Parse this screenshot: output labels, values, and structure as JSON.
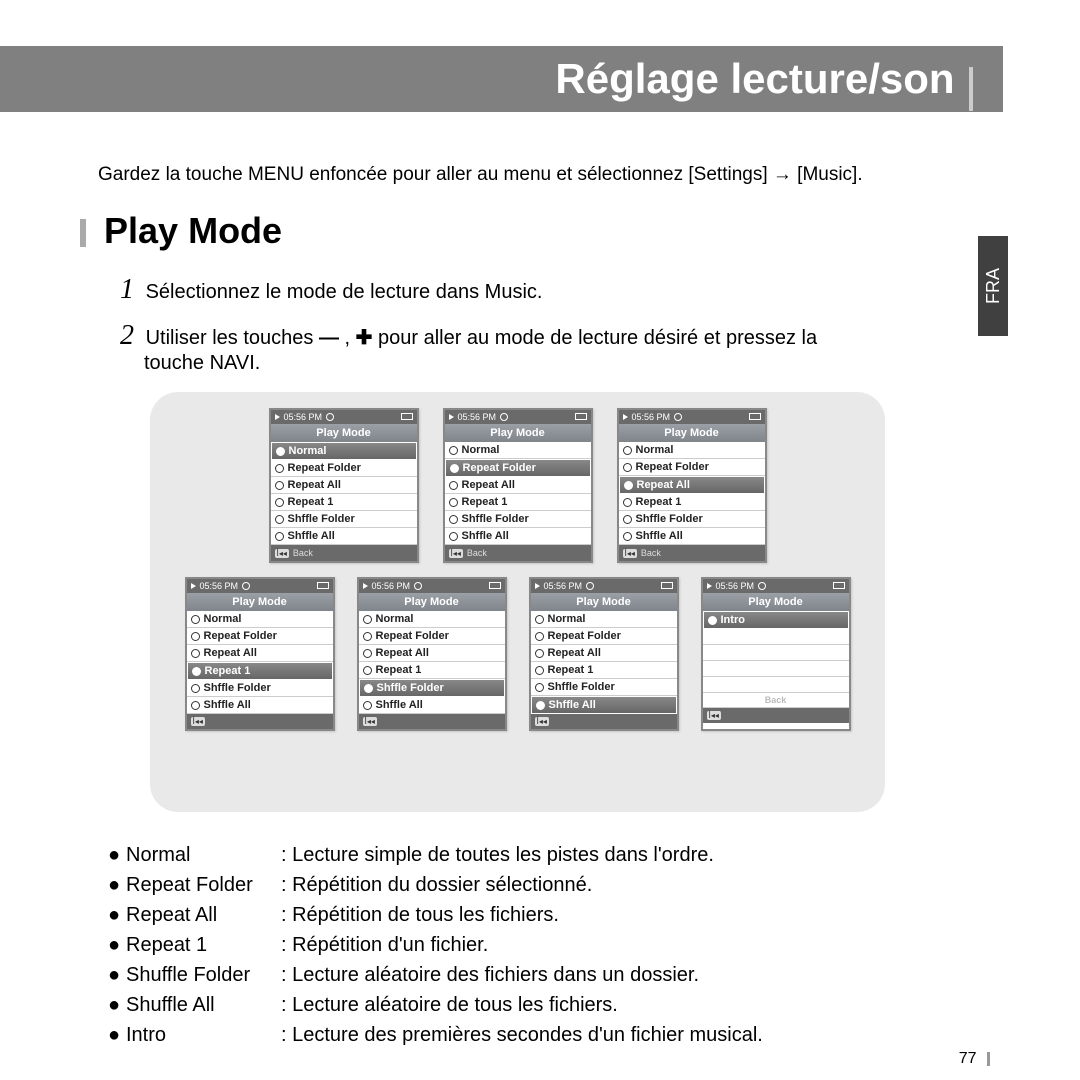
{
  "title": "Réglage lecture/son",
  "intro": "Gardez la touche MENU enfoncée pour aller au menu et sélectionnez [Settings] → [Music].",
  "section_title": "Play Mode",
  "fra_label": "FRA",
  "steps": {
    "s1": "Sélectionnez le mode de lecture dans Music.",
    "s2a": "Utiliser les touches",
    "s2b": "pour aller au mode de lecture désiré et pressez la",
    "s2c": "touche NAVI."
  },
  "device_common": {
    "time": "05:56 PM",
    "header": "Play Mode",
    "back": "Back",
    "items": [
      "Normal",
      "Repeat Folder",
      "Repeat All",
      "Repeat 1",
      "Shffle Folder",
      "Shffle All"
    ]
  },
  "selections_row1": [
    0,
    1,
    2
  ],
  "selections_row2": [
    3,
    4,
    5
  ],
  "intro_item": "Intro",
  "descs": [
    {
      "label": "Normal",
      "colon": ":",
      "text": "Lecture simple de toutes les pistes dans l'ordre."
    },
    {
      "label": "Repeat Folder",
      "colon": ":",
      "text": "Répétition du dossier sélectionné."
    },
    {
      "label": "Repeat All",
      "colon": ":",
      "text": "Répétition de tous les fichiers."
    },
    {
      "label": "Repeat 1",
      "colon": ":",
      "text": "Répétition d'un fichier."
    },
    {
      "label": "Shuffle Folder",
      "colon": ":",
      "text": "Lecture aléatoire des fichiers dans un dossier."
    },
    {
      "label": "Shuffle All",
      "colon": ":",
      "text": "Lecture aléatoire de tous les fichiers."
    },
    {
      "label": "Intro",
      "colon": ":",
      "text": "Lecture des premières secondes d'un fichier musical."
    }
  ],
  "page_num": "77"
}
